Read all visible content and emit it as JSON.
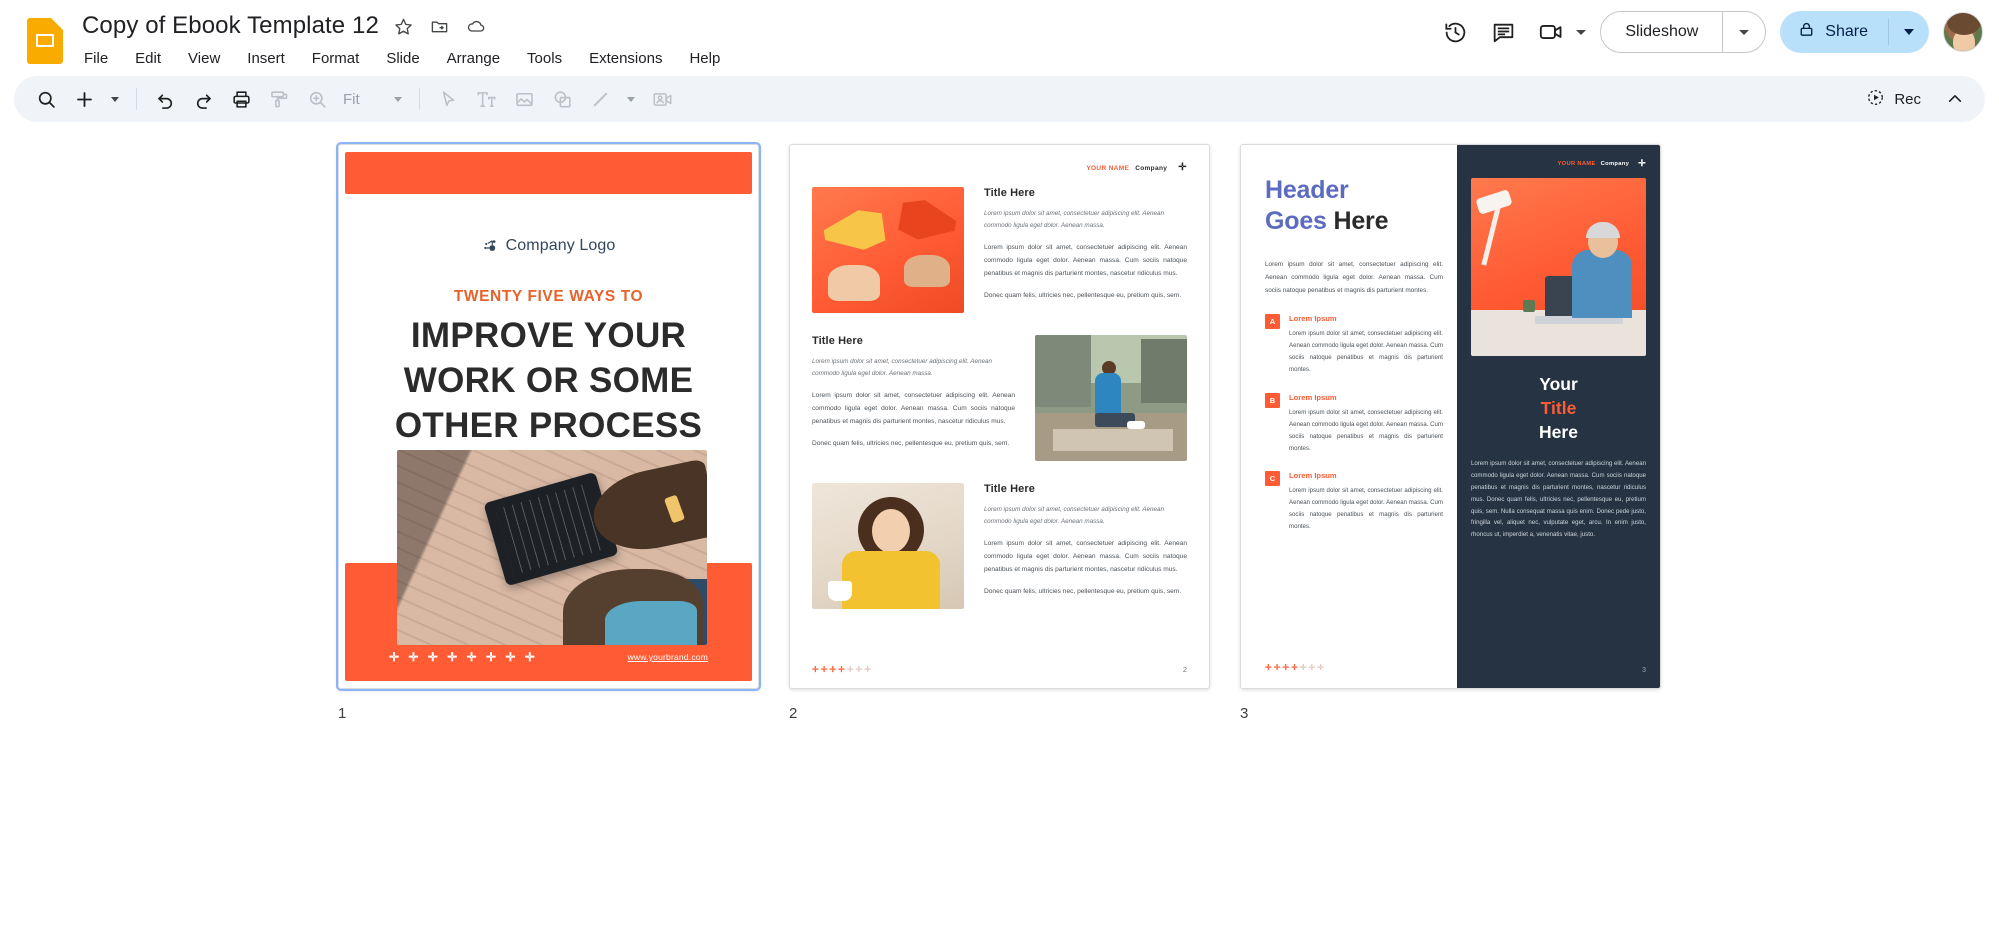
{
  "app": {
    "doc_title": "Copy of Ebook Template 12",
    "logo_icon": "google-slides-icon",
    "star_icon": "star-icon",
    "move_icon": "move-to-folder-icon",
    "cloud_icon": "cloud-saved-icon"
  },
  "menu": {
    "items": [
      "File",
      "Edit",
      "View",
      "Insert",
      "Format",
      "Slide",
      "Arrange",
      "Tools",
      "Extensions",
      "Help"
    ]
  },
  "header_right": {
    "history_icon": "version-history-icon",
    "comment_icon": "comment-icon",
    "meet_icon": "google-meet-camera-icon",
    "slideshow_label": "Slideshow",
    "slideshow_arrow_icon": "chevron-down-icon",
    "share_label": "Share",
    "share_lock_icon": "lock-icon",
    "share_arrow_icon": "chevron-down-icon",
    "avatar_name": "user-avatar"
  },
  "toolbar": {
    "search_icon": "search-icon",
    "new_slide_icon": "add-slide-icon",
    "new_slide_arrow_icon": "chevron-down-icon",
    "undo_icon": "undo-icon",
    "redo_icon": "redo-icon",
    "print_icon": "print-icon",
    "paint_format_icon": "paint-format-icon",
    "zoom_icon": "zoom-icon",
    "zoom_value": "Fit",
    "zoom_arrow_icon": "chevron-down-icon",
    "select_icon": "cursor-select-icon",
    "textbox_icon": "text-box-icon",
    "image_icon": "insert-image-icon",
    "shape_icon": "insert-shape-icon",
    "line_icon": "insert-line-icon",
    "line_arrow_icon": "chevron-down-icon",
    "video_icon": "insert-video-icon",
    "rec_label": "Rec",
    "rec_icon": "record-icon",
    "collapse_icon": "chevron-up-icon"
  },
  "slides": [
    {
      "number": "1",
      "selected": true,
      "logo_text": "Company Logo",
      "eyebrow": "TWENTY FIVE WAYS TO",
      "headline_lines": [
        "IMPROVE   YOUR",
        "WORK OR SOME",
        "OTHER PROCESS"
      ],
      "footer_dots": "✛ ✛ ✛ ✛ ✛ ✛ ✛ ✛",
      "footer_url": "www.yourbrand.com",
      "photo_alt": "person-pointing-at-tablet-on-brick-ground"
    },
    {
      "number": "2",
      "selected": false,
      "brand_name": "YOUR NAME",
      "brand_company": "Company",
      "blocks": [
        {
          "title": "Title Here",
          "italic": "Lorem ipsum dolor sit amet, consectetuer adipiscing elit. Aenean commodo ligula eget dolor. Aenean massa.",
          "body": "Lorem ipsum dolor sit amet, consectetuer adipiscing elit. Aenean commodo ligula eget dolor. Aenean massa. Cum sociis natoque penatibus et magnis dis parturient montes, nascetur ridiculus mus.",
          "body2": "Donec quam felis, ultricies nec, pellentesque eu, pretium quis, sem.",
          "image_alt": "two-hands-holding-megaphones"
        },
        {
          "title": "Title Here",
          "italic": "Lorem ipsum dolor sit amet, consectetuer adipiscing elit. Aenean commodo ligula eget dolor. Aenean massa.",
          "body": "Lorem ipsum dolor sit amet, consectetuer adipiscing elit. Aenean commodo ligula eget dolor. Aenean massa. Cum sociis natoque penatibus et magnis dis parturient montes, nascetur ridiculus mus.",
          "body2": "Donec quam felis, ultricies nec, pellentesque eu, pretium quis, sem.",
          "image_alt": "man-sitting-on-ledge-with-phone"
        },
        {
          "title": "Title Here",
          "italic": "Lorem ipsum dolor sit amet, consectetuer adipiscing elit. Aenean commodo ligula eget dolor. Aenean massa.",
          "body": "Lorem ipsum dolor sit amet, consectetuer adipiscing elit. Aenean commodo ligula eget dolor. Aenean massa. Cum sociis natoque penatibus et magnis dis parturient montes, nascetur ridiculus mus.",
          "body2": "Donec quam felis, ultricies nec, pellentesque eu, pretium quis, sem.",
          "image_alt": "woman-in-yellow-top-with-tablet"
        }
      ],
      "page_dots_on": "✛✛✛✛",
      "page_dots_off": "✛✛✛",
      "page_number": "2"
    },
    {
      "number": "3",
      "selected": false,
      "brand_name": "YOUR NAME",
      "brand_company": "Company",
      "header_line1_blue": "Header",
      "header_line2_blue": "Goes ",
      "header_line2_dark": "Here",
      "lead": "Lorem ipsum dolor sit amet, consectetuer adipiscing elit. Aenean commodo ligula eget dolor. Aenean massa. Cum sociis natoque penatibus et magnis dis parturient montes.",
      "items": [
        {
          "badge": "A",
          "heading": "Lorem Ipsum",
          "body": "Lorem ipsum dolor sit amet, consectetuer adipiscing elit. Aenean commodo ligula eget dolor. Aenean massa. Cum sociis natoque penatibus et magnis dis parturient montes."
        },
        {
          "badge": "B",
          "heading": "Lorem Ipsum",
          "body": "Lorem ipsum dolor sit amet, consectetuer adipiscing elit. Aenean commodo ligula eget dolor. Aenean massa. Cum sociis natoque penatibus et magnis dis parturient montes."
        },
        {
          "badge": "C",
          "heading": "Lorem Ipsum",
          "body": "Lorem ipsum dolor sit amet, consectetuer adipiscing elit. Aenean commodo ligula eget dolor. Aenean massa. Cum sociis natoque penatibus et magnis dis parturient montes."
        }
      ],
      "page_dots_on": "✛✛✛✛",
      "page_dots_off": "✛✛✛",
      "right_title_l1": "Your",
      "right_title_l2": "Title",
      "right_title_l3": "Here",
      "right_body": "Lorem ipsum dolor sit amet, consectetuer adipiscing elit. Aenean commodo ligula eget dolor. Aenean massa. Cum sociis natoque penatibus et magnis dis parturient montes, nascetur ridiculus mus. Donec quam felis, ultricies nec, pellentesque eu, pretium quis, sem. Nulla consequat massa quis enim. Donec pede justo, fringilla vel, aliquet nec, vulputate eget, arcu. In enim justo, rhoncus ut, imperdiet a, venenatis vitae, justo.",
      "page_number": "3",
      "image_alt": "man-working-at-desk-with-laptop-and-lamp"
    }
  ],
  "colors": {
    "brand_orange": "#FF5C35",
    "eyebrow_orange": "#E8622C",
    "dark_navy": "#253342",
    "header_blue": "#5C6BC0",
    "share_blue": "#b9e0fb",
    "toolbar_bg": "#f0f4f9"
  }
}
